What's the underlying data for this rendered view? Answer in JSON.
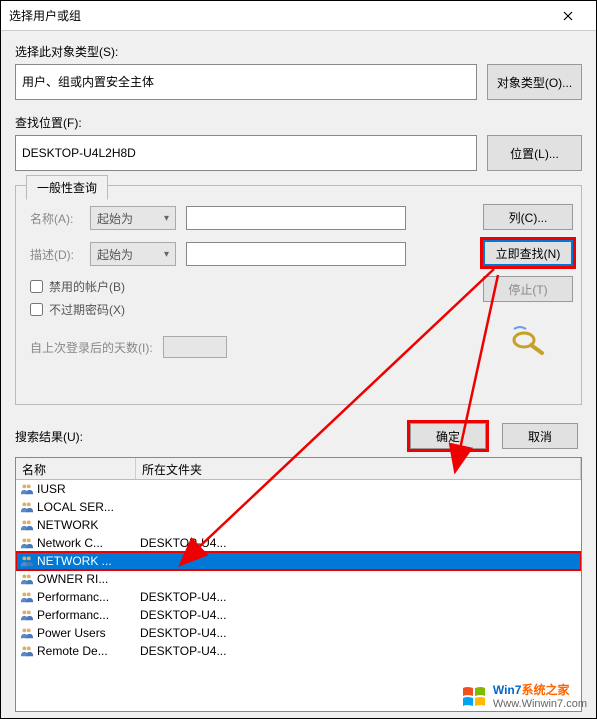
{
  "dialog": {
    "title": "选择用户或组"
  },
  "object_type": {
    "label": "选择此对象类型(S):",
    "value": "用户、组或内置安全主体",
    "button": "对象类型(O)..."
  },
  "location": {
    "label": "查找位置(F):",
    "value": "DESKTOP-U4L2H8D",
    "button": "位置(L)..."
  },
  "query": {
    "tab": "一般性查询",
    "name_label": "名称(A):",
    "name_combo": "起始为",
    "desc_label": "描述(D):",
    "desc_combo": "起始为",
    "chk_disabled": "禁用的帐户(B)",
    "chk_noexpire": "不过期密码(X)",
    "days_label": "自上次登录后的天数(I):"
  },
  "side_buttons": {
    "columns": "列(C)...",
    "find_now": "立即查找(N)",
    "stop": "停止(T)"
  },
  "actions": {
    "results_label": "搜索结果(U):",
    "ok": "确定",
    "cancel": "取消"
  },
  "results": {
    "col_name": "名称",
    "col_folder": "所在文件夹",
    "rows": [
      {
        "name": "IUSR",
        "folder": "",
        "type": "group"
      },
      {
        "name": "LOCAL SER...",
        "folder": "",
        "type": "group"
      },
      {
        "name": "NETWORK",
        "folder": "",
        "type": "group"
      },
      {
        "name": "Network C...",
        "folder": "DESKTOP-U4...",
        "type": "group"
      },
      {
        "name": "NETWORK ...",
        "folder": "",
        "type": "group",
        "selected": true
      },
      {
        "name": "OWNER RI...",
        "folder": "",
        "type": "group"
      },
      {
        "name": "Performanc...",
        "folder": "DESKTOP-U4...",
        "type": "group"
      },
      {
        "name": "Performanc...",
        "folder": "DESKTOP-U4...",
        "type": "group"
      },
      {
        "name": "Power Users",
        "folder": "DESKTOP-U4...",
        "type": "group"
      },
      {
        "name": "Remote De...",
        "folder": "DESKTOP-U4...",
        "type": "group"
      }
    ]
  },
  "watermark": {
    "brand_a": "Win7",
    "brand_b": "系统之家",
    "url": "Www.Winwin7.com"
  }
}
